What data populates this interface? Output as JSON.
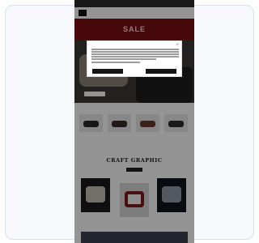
{
  "site": {
    "topbar_text": "",
    "nav_links": [
      "",
      "",
      "",
      "",
      "",
      "",
      ""
    ]
  },
  "hero": {
    "sale_text": "SALE",
    "cta_label": ""
  },
  "products": {
    "heading": "",
    "items": [
      {
        "title": "",
        "price": "",
        "accent": "#2a2a2a"
      },
      {
        "title": "",
        "price": "",
        "accent": "#3b2a2a"
      },
      {
        "title": "",
        "price": "",
        "accent": "#6a3a2b"
      },
      {
        "title": "",
        "price": "",
        "accent": "#2d2d2d"
      }
    ]
  },
  "craft": {
    "heading": "CRAFT GRAPHIC",
    "button_label": ""
  },
  "cookie": {
    "title": "",
    "accept_label": "",
    "reject_label": ""
  },
  "colors": {
    "sale_red": "#7a0f12",
    "overlay": "rgba(0,0,0,0.42)",
    "frame_border": "#d9dfea"
  }
}
